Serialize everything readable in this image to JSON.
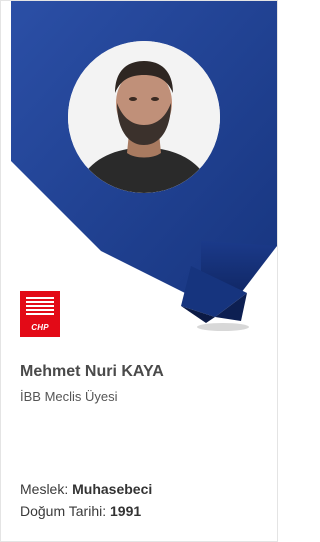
{
  "profile": {
    "name": "Mehmet Nuri KAYA",
    "title": "İBB Meclis Üyesi"
  },
  "party_logo": {
    "text": "CHP",
    "color": "#e30a17",
    "icon": "six-arrows-icon"
  },
  "details": {
    "occupation_label": "Meslek: ",
    "occupation_value": "Muhasebeci",
    "birth_label": "Doğum Tarihi: ",
    "birth_value": "1991"
  },
  "colors": {
    "banner": "#1f3f8e",
    "banner_dark": "#132a66",
    "accent_red": "#e30a17"
  }
}
